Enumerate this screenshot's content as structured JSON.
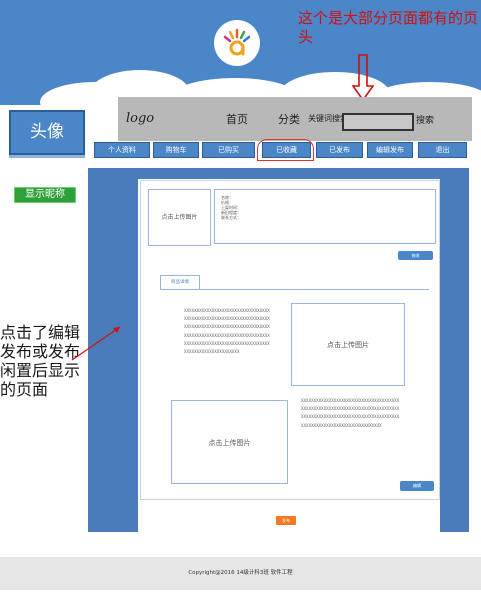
{
  "header": {
    "annotation": "这个是大部分页面都有的页头"
  },
  "sketch": {
    "logo": "logo",
    "home": "首页",
    "category": "分类",
    "search_label": "关键词搜索",
    "search_button": "搜索"
  },
  "sidebar": {
    "avatar_label": "头像",
    "nickname_label": "显示昵称"
  },
  "nav": {
    "items": [
      "个人资料",
      "购物车",
      "已购买",
      "已收藏",
      "已发布",
      "编辑发布",
      "退出"
    ]
  },
  "main": {
    "upload_image": "点击上传图片",
    "info_lines": [
      "名称：",
      "价格：",
      "上架时间：",
      "新旧程度：",
      "联系方式："
    ],
    "modify_button": "修改",
    "tab_detail": "商品详情",
    "desc_text_1": "XXXXXXXXXXXXXXXXXXXXXXXXXXXXXXXXXXXXXXXXXXXXXXXXXXXXXXXXXXXXXXXXXXXXXXXXXXXXXXXXXXXXXXXXXXXXXXXXXXXXXXXXXXXXXXXXXXXXXXXXXXXXXXXXXXXXXXXXXXXXXXXXXXXXXXXXXXXXXXXXXXXXXXXXXXXXXXXXXXXXXXXXXXXXXXXX",
    "desc_text_2": "XXXXXXXXXXXXXXXXXXXXXXXXXXXXXXXXXXXXXXXXXXXXXXXXXXXXXXXXXXXXXXXXXXXXXXXXXXXXXXXXXXXXXXXXXXXXXXXXXXXXXXXXXXXXXXXXXXXXXXXXXXXXXXXXXXXXXXXXXXXXXXXXXXXXX",
    "upload_image_2": "点击上传图片",
    "upload_image_3": "点击上传图片",
    "edit_button": "编辑",
    "publish_button": "发布"
  },
  "annotation_left": "点击了编辑发布或发布闲置后显示的页面",
  "footer": {
    "copyright": "Copyright@2016  14级计科3班  软件工程"
  },
  "colors": {
    "header_blue": "#4a86c8",
    "annotation_red": "#d40f0f",
    "publish_orange": "#f47920",
    "nickname_green": "#2f9f3a"
  }
}
